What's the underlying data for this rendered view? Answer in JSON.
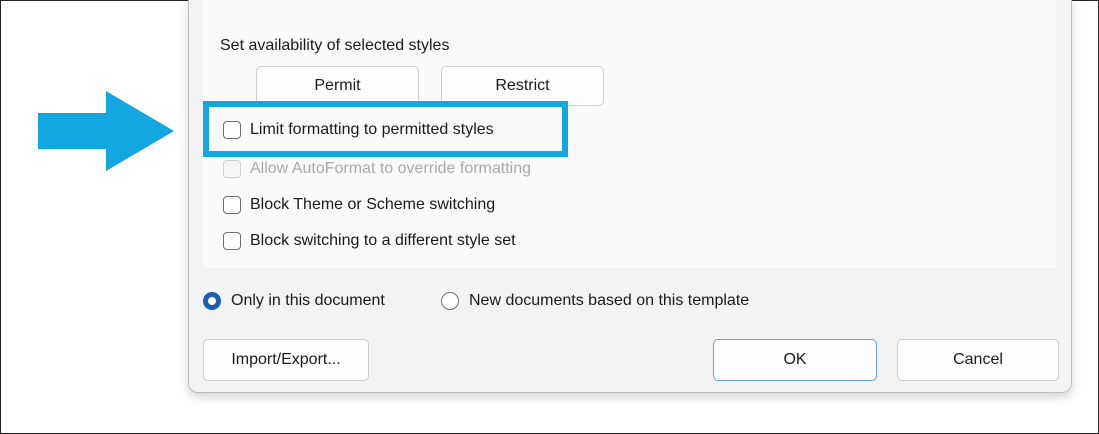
{
  "restrictions": {
    "section_label": "Set availability of selected styles",
    "permit_button": "Permit",
    "restrict_button": "Restrict"
  },
  "options": [
    {
      "label": "Limit formatting to permitted styles",
      "checked": false,
      "enabled": true
    },
    {
      "label": "Allow AutoFormat to override formatting",
      "checked": false,
      "enabled": false
    },
    {
      "label": "Block Theme or Scheme switching",
      "checked": false,
      "enabled": true
    },
    {
      "label": "Block switching to a different style set",
      "checked": false,
      "enabled": true
    }
  ],
  "scope": {
    "option_1": "Only in this document",
    "option_2": "New documents based on this template",
    "selected": "Only in this document"
  },
  "footer": {
    "import_export_button": "Import/Export...",
    "ok_button": "OK",
    "cancel_button": "Cancel"
  },
  "colors": {
    "highlight": "#12a7e0",
    "arrow": "#12a7e0",
    "radio_selected": "#1a5fb4"
  },
  "icons": {
    "pointer": "right-arrow-icon"
  }
}
